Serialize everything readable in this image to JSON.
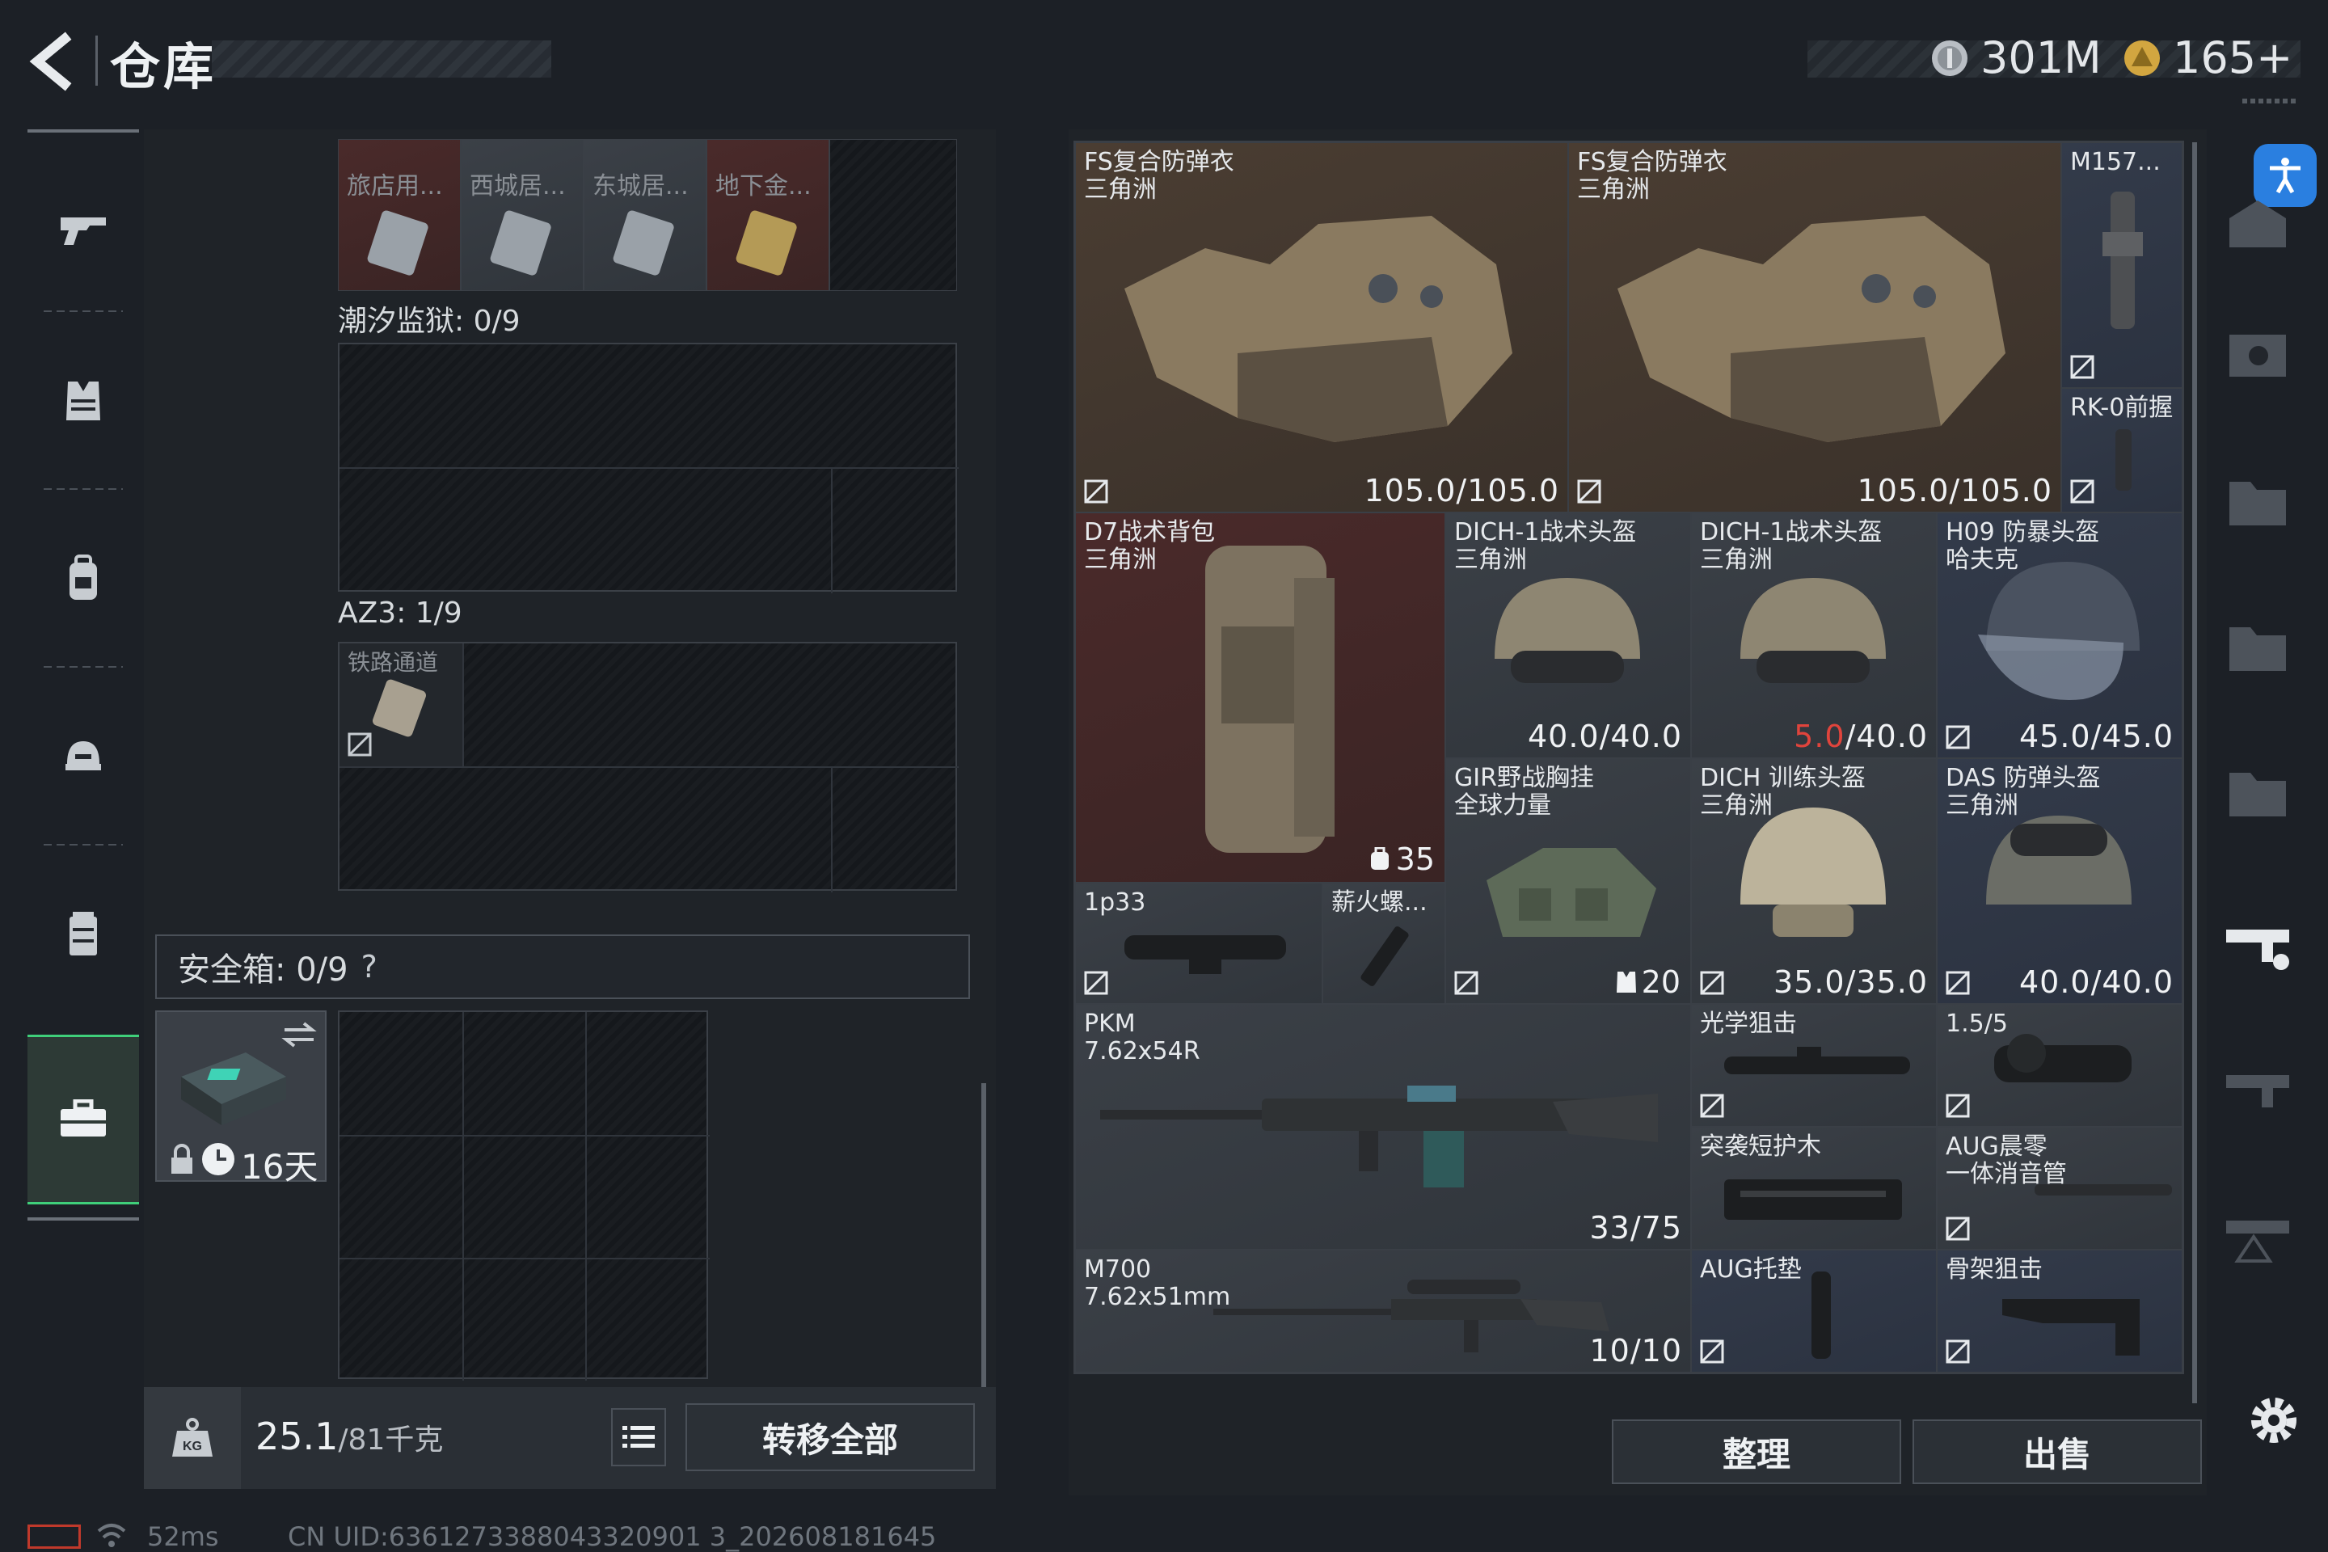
{
  "header": {
    "title": "仓库",
    "currencies": [
      {
        "icon": "silver-coin-icon",
        "value": "301M"
      },
      {
        "icon": "gold-coin-icon",
        "value": "165+"
      }
    ]
  },
  "left_nav": {
    "items": [
      {
        "name": "weapon",
        "icon": "gun-icon"
      },
      {
        "name": "armor",
        "icon": "vest-icon"
      },
      {
        "name": "backpack",
        "icon": "backpack-icon"
      },
      {
        "name": "helmet",
        "icon": "helmet-icon"
      },
      {
        "name": "chest-rig",
        "icon": "rig-icon"
      },
      {
        "name": "safe-box",
        "icon": "briefcase-icon",
        "active": true
      }
    ]
  },
  "containers": {
    "top_key_slots": [
      "旅店用...",
      "西城居...",
      "东城居...",
      "地下金..."
    ],
    "tide_prison": {
      "label": "潮汐监狱: 0/9"
    },
    "az3": {
      "label": "AZ3: 1/9",
      "item": "铁路通道"
    },
    "safe_box": {
      "label": "安全箱: 0/9",
      "help": "?",
      "days": "16天"
    }
  },
  "footer_left": {
    "weight_value": "25.1",
    "weight_max": "/81千克",
    "transfer_all": "转移全部"
  },
  "stash_items": [
    {
      "id": "fs1",
      "name": "FS复合防弹衣",
      "sub": "三角洲",
      "durability": "105.0/105.0"
    },
    {
      "id": "fs2",
      "name": "FS复合防弹衣",
      "sub": "三角洲",
      "durability": "105.0/105.0"
    },
    {
      "id": "m157",
      "name": "M157..."
    },
    {
      "id": "rk0",
      "name": "RK-0前握"
    },
    {
      "id": "d7",
      "name": "D7战术背包",
      "sub": "三角洲",
      "capacity": "35"
    },
    {
      "id": "dich1a",
      "name": "DICH-1战术头盔",
      "sub": "三角洲",
      "durability": "40.0/40.0"
    },
    {
      "id": "dich1b",
      "name": "DICH-1战术头盔",
      "sub": "三角洲",
      "durability_low": "5.0",
      "durability_max": "/40.0"
    },
    {
      "id": "h09",
      "name": "H09 防暴头盔",
      "sub": "哈夫克",
      "durability": "45.0/45.0"
    },
    {
      "id": "gir",
      "name": "GIR野战胸挂",
      "sub": "全球力量",
      "capacity": "20"
    },
    {
      "id": "dichtrain",
      "name": "DICH 训练头盔",
      "sub": "三角洲",
      "durability": "35.0/35.0"
    },
    {
      "id": "das",
      "name": "DAS 防弹头盔",
      "sub": "三角洲",
      "durability": "40.0/40.0"
    },
    {
      "id": "p1p33",
      "name": "1p33"
    },
    {
      "id": "xinhuo",
      "name": "薪火螺..."
    },
    {
      "id": "pkm",
      "name": "PKM",
      "sub": "7.62x54R",
      "ammo": "33/75"
    },
    {
      "id": "optic",
      "name": "光学狙击"
    },
    {
      "id": "scope15",
      "name": "1.5/5"
    },
    {
      "id": "handguard",
      "name": "突袭短护木"
    },
    {
      "id": "augsup",
      "name": "AUG晨零",
      "sub": "一体消音管"
    },
    {
      "id": "m700",
      "name": "M700",
      "sub": "7.62x51mm",
      "ammo": "10/10"
    },
    {
      "id": "augpad",
      "name": "AUG托垫"
    },
    {
      "id": "skeleton",
      "name": "骨架狙击"
    }
  ],
  "footer_right": {
    "sort": "整理",
    "sell": "出售"
  },
  "status_bar": {
    "ping": "52ms",
    "uid": "CN UID:6361273388043320901 3_202608181645"
  },
  "colors": {
    "accent_green": "#3fcf7a",
    "accent_blue": "#2a7fe0",
    "danger_red": "#e0443c"
  }
}
